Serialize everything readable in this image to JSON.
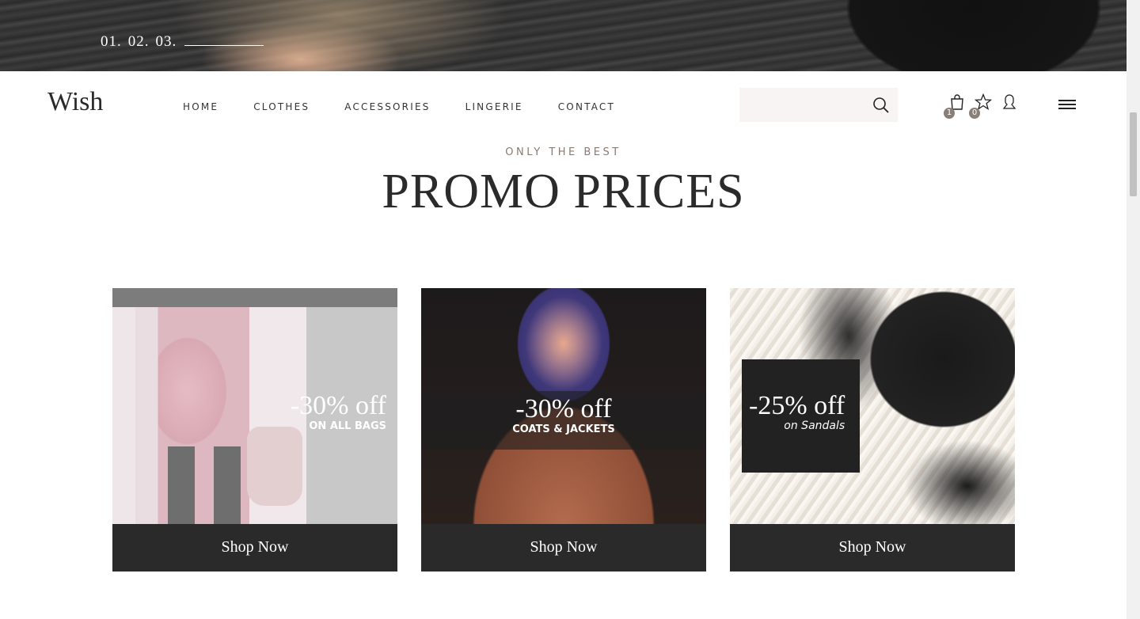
{
  "hero": {
    "slides": [
      "01.",
      "02.",
      "03."
    ]
  },
  "header": {
    "logo": "Wish",
    "nav": [
      "HOME",
      "CLOTHES",
      "ACCESSORIES",
      "LINGERIE",
      "CONTACT"
    ],
    "search": {
      "placeholder": ""
    },
    "cart_count": "1",
    "wishlist_count": "0"
  },
  "section": {
    "eyebrow": "ONLY THE BEST",
    "title": "PROMO PRICES"
  },
  "promos": [
    {
      "discount": "-30% off",
      "label": "ON ALL BAGS",
      "cta": "Shop Now"
    },
    {
      "discount": "-30% off",
      "label": "COATS & JACKETS",
      "cta": "Shop Now"
    },
    {
      "discount": "-25% off",
      "label": "on Sandals",
      "cta": "Shop Now"
    }
  ],
  "colors": {
    "accent": "#8b7d77",
    "dark": "#2a2a2a",
    "search_bg": "#f7f4f3"
  }
}
